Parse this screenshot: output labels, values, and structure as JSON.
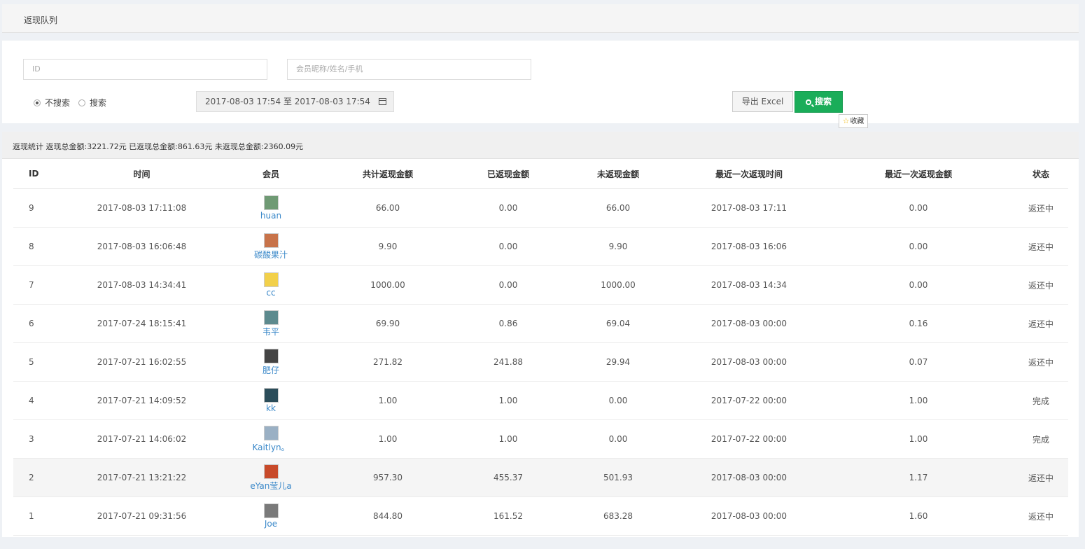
{
  "header": {
    "title": "返现队列"
  },
  "filter": {
    "id_placeholder": "ID",
    "member_placeholder": "会员昵称/姓名/手机",
    "radio_no_search": "不搜索",
    "radio_search": "搜索",
    "date_range": "2017-08-03 17:54 至 2017-08-03 17:54",
    "export_label": "导出 Excel",
    "search_label": "搜索",
    "tooltip_label": "收藏",
    "tooltip_icon": "star-icon"
  },
  "stats": {
    "text": "返现统计 返现总金额:3221.72元 已返现总金额:861.63元 未返现总金额:2360.09元"
  },
  "table": {
    "headers": [
      "ID",
      "时间",
      "会员",
      "共计返现金额",
      "已返现金额",
      "未返现金额",
      "最近一次返现时间",
      "最近一次返现金额",
      "状态"
    ],
    "rows": [
      {
        "id": "9",
        "time": "2017-08-03 17:11:08",
        "member": "huan",
        "total": "66.00",
        "returned": "0.00",
        "remaining": "66.00",
        "last_time": "2017-08-03 17:11",
        "last_amount": "0.00",
        "status": "返还中",
        "avatar_color": "#6f9a74"
      },
      {
        "id": "8",
        "time": "2017-08-03 16:06:48",
        "member": "碳酸果汁",
        "total": "9.90",
        "returned": "0.00",
        "remaining": "9.90",
        "last_time": "2017-08-03 16:06",
        "last_amount": "0.00",
        "status": "返还中",
        "avatar_color": "#c8734a"
      },
      {
        "id": "7",
        "time": "2017-08-03 14:34:41",
        "member": "cc",
        "total": "1000.00",
        "returned": "0.00",
        "remaining": "1000.00",
        "last_time": "2017-08-03 14:34",
        "last_amount": "0.00",
        "status": "返还中",
        "avatar_color": "#f2d04a"
      },
      {
        "id": "6",
        "time": "2017-07-24 18:15:41",
        "member": "韦平",
        "total": "69.90",
        "returned": "0.86",
        "remaining": "69.04",
        "last_time": "2017-08-03 00:00",
        "last_amount": "0.16",
        "status": "返还中",
        "avatar_color": "#5d8a8e"
      },
      {
        "id": "5",
        "time": "2017-07-21 16:02:55",
        "member": "肥仔",
        "total": "271.82",
        "returned": "241.88",
        "remaining": "29.94",
        "last_time": "2017-08-03 00:00",
        "last_amount": "0.07",
        "status": "返还中",
        "avatar_color": "#444444"
      },
      {
        "id": "4",
        "time": "2017-07-21 14:09:52",
        "member": "kk",
        "total": "1.00",
        "returned": "1.00",
        "remaining": "0.00",
        "last_time": "2017-07-22 00:00",
        "last_amount": "1.00",
        "status": "完成",
        "avatar_color": "#2b4d5a"
      },
      {
        "id": "3",
        "time": "2017-07-21 14:06:02",
        "member": "Kaitlyn。",
        "total": "1.00",
        "returned": "1.00",
        "remaining": "0.00",
        "last_time": "2017-07-22 00:00",
        "last_amount": "1.00",
        "status": "完成",
        "avatar_color": "#9ab0c4"
      },
      {
        "id": "2",
        "time": "2017-07-21 13:21:22",
        "member": "eYan莹儿a",
        "total": "957.30",
        "returned": "455.37",
        "remaining": "501.93",
        "last_time": "2017-08-03 00:00",
        "last_amount": "1.17",
        "status": "返还中",
        "avatar_color": "#c84a2a"
      },
      {
        "id": "1",
        "time": "2017-07-21 09:31:56",
        "member": "Joe",
        "total": "844.80",
        "returned": "161.52",
        "remaining": "683.28",
        "last_time": "2017-08-03 00:00",
        "last_amount": "1.60",
        "status": "返还中",
        "avatar_color": "#7a7a7a"
      }
    ]
  }
}
